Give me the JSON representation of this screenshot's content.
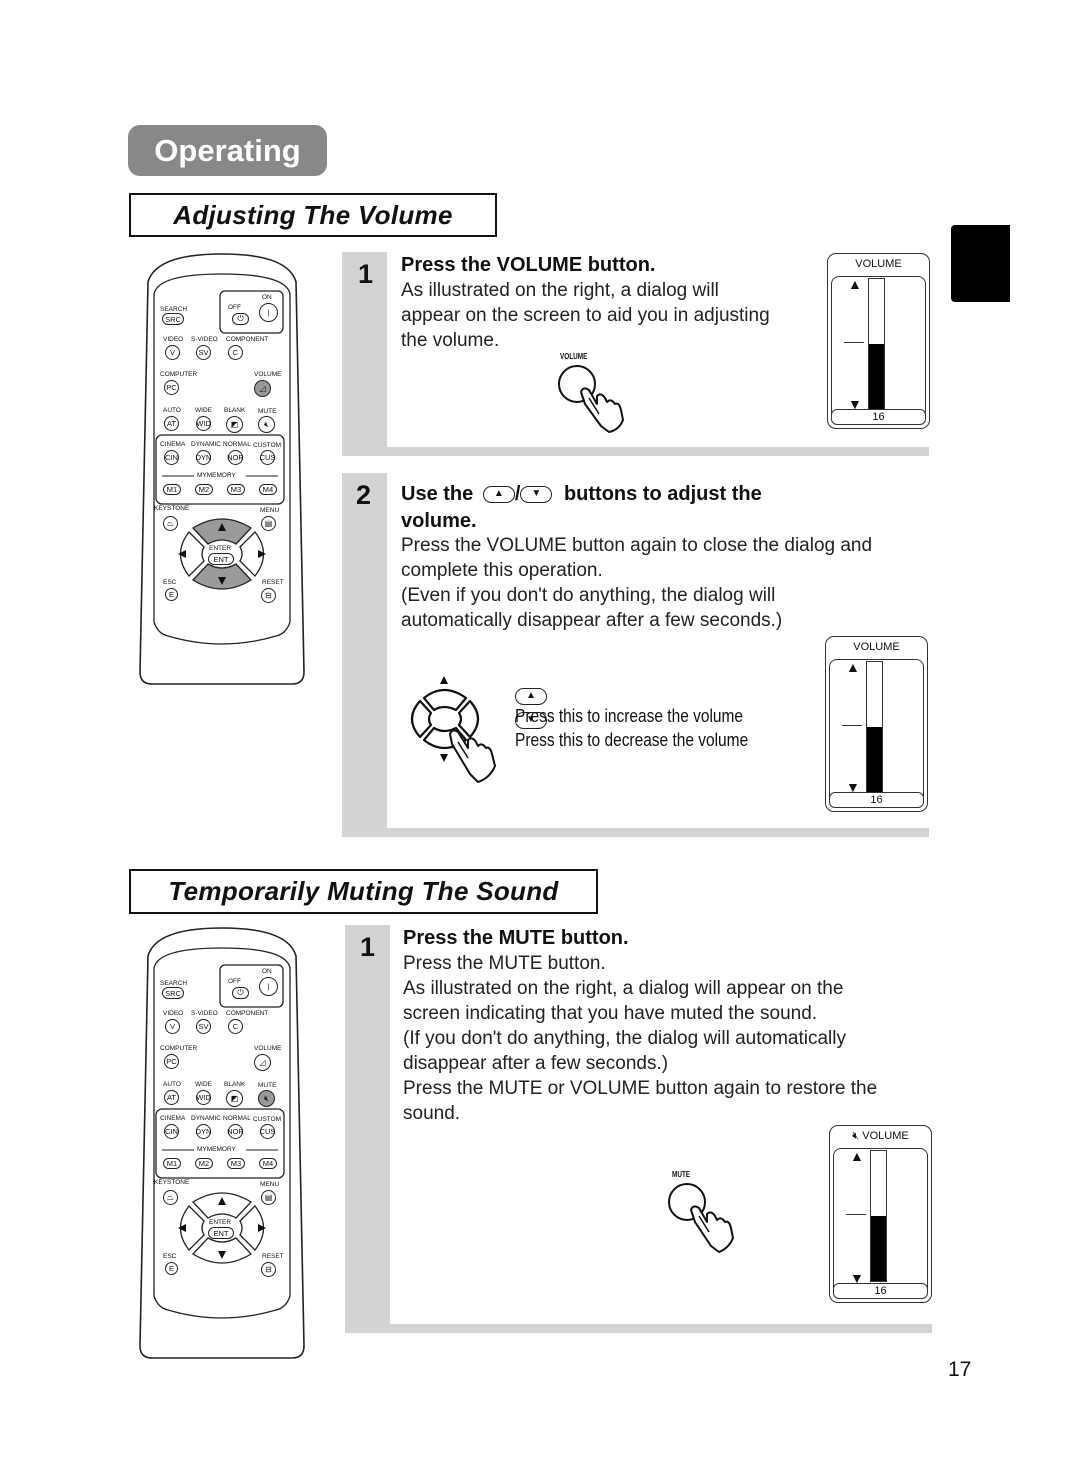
{
  "page": {
    "chapter_label": "Operating",
    "page_number": "17"
  },
  "section_volume": {
    "title": "Adjusting The Volume",
    "steps": [
      {
        "number": "1",
        "heading": "Press the VOLUME button.",
        "body": [
          "As illustrated on the right, a dialog will",
          "appear on the screen to aid you in adjusting",
          "the volume."
        ],
        "illustration_label": "VOLUME",
        "dialog": {
          "title": "VOLUME",
          "value": "16",
          "level_fraction": 0.5
        }
      },
      {
        "number": "2",
        "heading_prefix": "Use the",
        "heading_sep": "/",
        "heading_suffix": "buttons to adjust the",
        "heading_line2": "volume.",
        "body": [
          "Press the VOLUME button again to close the dialog and",
          "complete this operation.",
          "(Even if you don't do anything, the dialog will",
          "automatically disappear after a few seconds.)"
        ],
        "legend": [
          {
            "icon": "up-arrow-button-icon",
            "glyph": "▲",
            "text": "Press this to increase the volume"
          },
          {
            "icon": "down-arrow-button-icon",
            "glyph": "▼",
            "text": "Press this to decrease the volume"
          }
        ],
        "dialog": {
          "title": "VOLUME",
          "value": "16",
          "level_fraction": 0.5
        }
      }
    ]
  },
  "section_mute": {
    "title": "Temporarily Muting The Sound",
    "steps": [
      {
        "number": "1",
        "heading": "Press the MUTE button.",
        "body": [
          "Press the MUTE button.",
          "As illustrated on the right, a dialog will appear on the",
          "screen indicating that you have muted the sound.",
          "(If you don't do anything, the dialog will automatically",
          "disappear after a few seconds.)",
          "Press the MUTE or VOLUME button again to restore the",
          "sound."
        ],
        "illustration_label": "MUTE",
        "dialog": {
          "title": "VOLUME",
          "value": "16",
          "level_fraction": 0.5,
          "muted": true
        }
      }
    ]
  },
  "remote": {
    "labels": {
      "search": "SEARCH",
      "off": "OFF",
      "on": "ON",
      "video": "VIDEO",
      "svideo": "S-VIDEO",
      "component": "COMPONENT",
      "computer": "COMPUTER",
      "volume": "VOLUME",
      "auto": "AUTO",
      "wide": "WIDE",
      "blank": "BLANK",
      "mute": "MUTE",
      "cinema": "CINEMA",
      "dynamic": "DYNAMIC",
      "normal": "NORMAL",
      "custom": "CUSTOM",
      "mymemory": "MYMEMORY",
      "keystone": "KEYSTONE",
      "menu": "MENU",
      "enter": "ENTER",
      "esc": "ESC",
      "reset": "RESET"
    },
    "buttons": {
      "src": "SRC",
      "on": "|",
      "v": "V",
      "sv": "SV",
      "c": "C",
      "pc": "PC",
      "at": "AT",
      "wid": "WID",
      "cin": "CIN",
      "dyn": "DYN",
      "nor": "NOR",
      "cus": "CUS",
      "m1": "M1",
      "m2": "M2",
      "m3": "M3",
      "m4": "M4",
      "ent": "ENT",
      "e": "E"
    },
    "highlight_colors": {
      "pressed": "#9a9a9a"
    }
  }
}
